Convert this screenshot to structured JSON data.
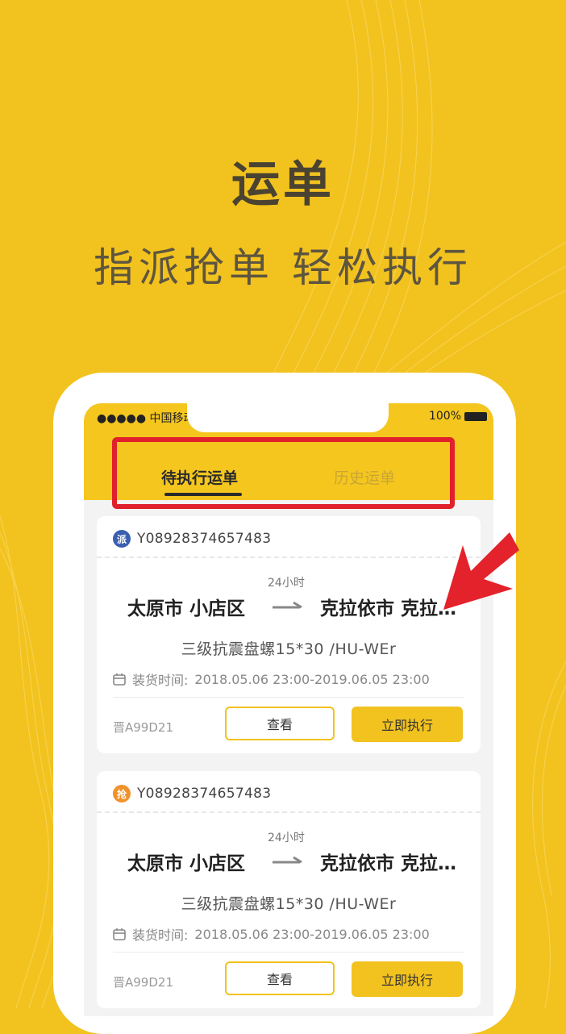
{
  "promo": {
    "headline": "运单",
    "subline": "指派抢单  轻松执行"
  },
  "phone": {
    "status": {
      "carrier": "●●●●● 中国移动",
      "battery": "100%"
    },
    "tabs": [
      {
        "label": "待执行运单",
        "active": true
      },
      {
        "label": "历史运单",
        "active": false
      }
    ],
    "orders": [
      {
        "badge": "派",
        "badge_color": "#3a5fb0",
        "order_no": "Y08928374657483",
        "from": "太原市 小店区",
        "to": "克拉依市 克拉…",
        "duration": "24小时",
        "goods": "三级抗震盘螺15*30 /HU-WEr",
        "load_time_label": "装货时间:",
        "load_time": "2018.05.06 23:00-2019.06.05 23:00",
        "plate": "晋A99D21",
        "view_label": "查看",
        "exec_label": "立即执行"
      },
      {
        "badge": "抢",
        "badge_color": "#f0922b",
        "order_no": "Y08928374657483",
        "from": "太原市 小店区",
        "to": "克拉依市 克拉…",
        "duration": "24小时",
        "goods": "三级抗震盘螺15*30 /HU-WEr",
        "load_time_label": "装货时间:",
        "load_time": "2018.05.06 23:00-2019.06.05 23:00",
        "plate": "晋A99D21",
        "view_label": "查看",
        "exec_label": "立即执行"
      }
    ]
  },
  "colors": {
    "background": "#f2c21f",
    "highlight": "#e0202a",
    "accent": "#f2c21f"
  }
}
